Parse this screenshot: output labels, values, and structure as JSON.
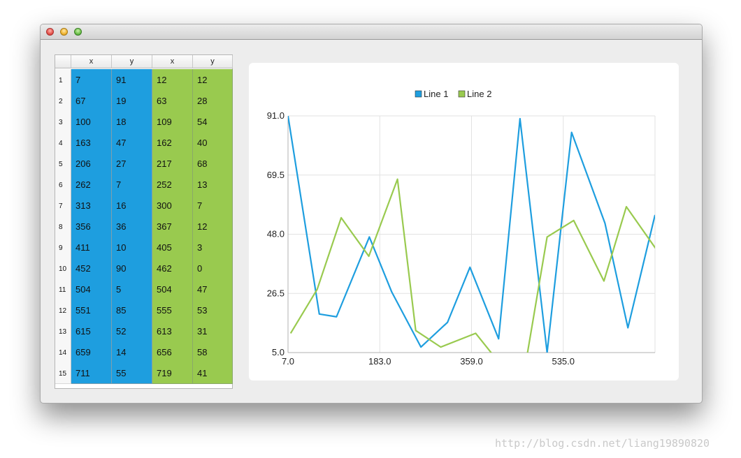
{
  "window": {
    "controls": [
      "close-button",
      "minimize-button",
      "zoom-button"
    ]
  },
  "table": {
    "headers": [
      "x",
      "y",
      "x",
      "y"
    ],
    "rows": [
      {
        "n": "1",
        "x1": "7",
        "y1": "91",
        "x2": "12",
        "y2": "12"
      },
      {
        "n": "2",
        "x1": "67",
        "y1": "19",
        "x2": "63",
        "y2": "28"
      },
      {
        "n": "3",
        "x1": "100",
        "y1": "18",
        "x2": "109",
        "y2": "54"
      },
      {
        "n": "4",
        "x1": "163",
        "y1": "47",
        "x2": "162",
        "y2": "40"
      },
      {
        "n": "5",
        "x1": "206",
        "y1": "27",
        "x2": "217",
        "y2": "68"
      },
      {
        "n": "6",
        "x1": "262",
        "y1": "7",
        "x2": "252",
        "y2": "13"
      },
      {
        "n": "7",
        "x1": "313",
        "y1": "16",
        "x2": "300",
        "y2": "7"
      },
      {
        "n": "8",
        "x1": "356",
        "y1": "36",
        "x2": "367",
        "y2": "12"
      },
      {
        "n": "9",
        "x1": "411",
        "y1": "10",
        "x2": "405",
        "y2": "3"
      },
      {
        "n": "10",
        "x1": "452",
        "y1": "90",
        "x2": "462",
        "y2": "0"
      },
      {
        "n": "11",
        "x1": "504",
        "y1": "5",
        "x2": "504",
        "y2": "47"
      },
      {
        "n": "12",
        "x1": "551",
        "y1": "85",
        "x2": "555",
        "y2": "53"
      },
      {
        "n": "13",
        "x1": "615",
        "y1": "52",
        "x2": "613",
        "y2": "31"
      },
      {
        "n": "14",
        "x1": "659",
        "y1": "14",
        "x2": "656",
        "y2": "58"
      },
      {
        "n": "15",
        "x1": "711",
        "y1": "55",
        "x2": "719",
        "y2": "41"
      }
    ]
  },
  "colors": {
    "line1": "#1e9edf",
    "line2": "#99ca4f",
    "grid": "#e2e2e2"
  },
  "chart_data": {
    "type": "line",
    "series": [
      {
        "name": "Line 1",
        "color": "#1e9edf",
        "x": [
          7,
          67,
          100,
          163,
          206,
          262,
          313,
          356,
          411,
          452,
          504,
          551,
          615,
          659,
          711
        ],
        "y": [
          91,
          19,
          18,
          47,
          27,
          7,
          16,
          36,
          10,
          90,
          5,
          85,
          52,
          14,
          55
        ]
      },
      {
        "name": "Line 2",
        "color": "#99ca4f",
        "x": [
          12,
          63,
          109,
          162,
          217,
          252,
          300,
          367,
          405,
          462,
          504,
          555,
          613,
          656,
          719
        ],
        "y": [
          12,
          28,
          54,
          40,
          68,
          13,
          7,
          12,
          3,
          0,
          47,
          53,
          31,
          58,
          41
        ]
      }
    ],
    "xlim": [
      7.0,
      711.0
    ],
    "ylim": [
      5.0,
      91.0
    ],
    "xticks": [
      "7.0",
      "183.0",
      "359.0",
      "535.0"
    ],
    "xtick_values": [
      7,
      183,
      359,
      535
    ],
    "yticks": [
      "91.0",
      "69.5",
      "48.0",
      "26.5",
      "5.0"
    ],
    "ytick_values": [
      91,
      69.5,
      48,
      26.5,
      5
    ],
    "legend_position": "top-center",
    "grid": true
  },
  "watermark": "http://blog.csdn.net/liang19890820"
}
